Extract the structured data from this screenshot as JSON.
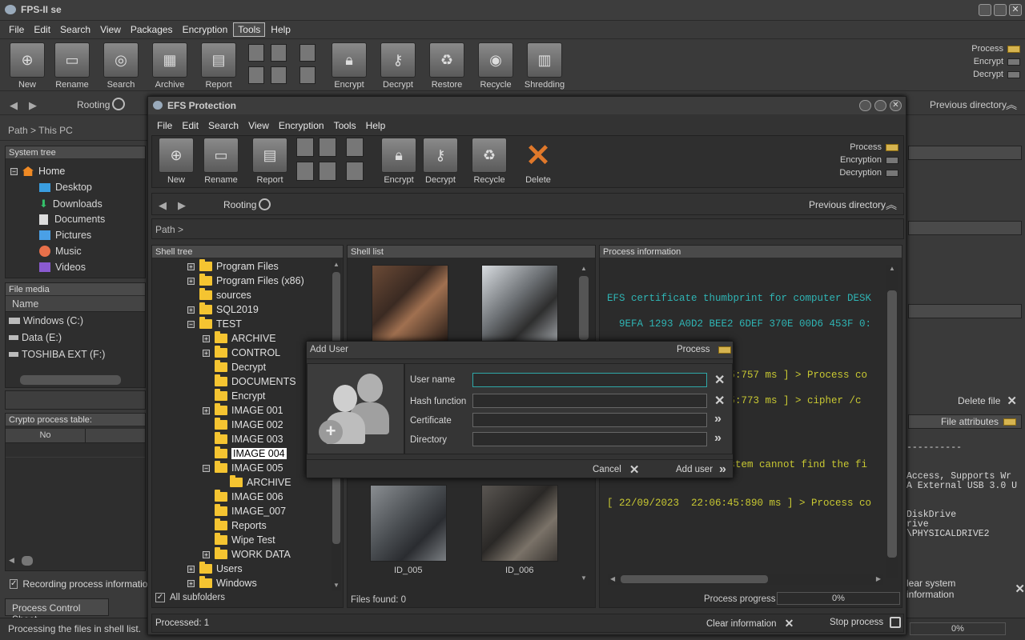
{
  "main": {
    "title": "FPS-II se",
    "menu": [
      "File",
      "Edit",
      "Search",
      "View",
      "Packages",
      "Encryption",
      "Tools",
      "Help"
    ],
    "toolbar": [
      "New",
      "Rename",
      "Search",
      "Archive",
      "Report",
      "Encrypt",
      "Decrypt",
      "Restore",
      "Recycle",
      "Shredding"
    ],
    "indicators": [
      "Process",
      "Encrypt",
      "Decrypt"
    ],
    "rooting": "Rooting",
    "previous_directory": "Previous directory",
    "path": "Path >  This PC",
    "system_tree_header": "System tree",
    "system_tree": [
      "Home",
      "Desktop",
      "Downloads",
      "Documents",
      "Pictures",
      "Music",
      "Videos"
    ],
    "file_media_header": "File media",
    "name_col": "Name",
    "drives": [
      "Windows  (C:)",
      "Data (E:)",
      "TOSHIBA EXT (F:)"
    ],
    "crypto_table_header": "Crypto process table:",
    "crypto_col_no": "No",
    "recording": "Recording process information C",
    "process_sheet_tab": "Process Control Sheet",
    "status": "Processing the files in shell list.",
    "delete_file": "Delete file",
    "file_attributes": "File attributes",
    "clear_system_info": "lear system information",
    "bottom_percent": "0%",
    "right_text": [
      "----------",
      "Access, Supports Wr",
      "A External USB 3.0 U",
      "DiskDrive",
      "rive",
      "\\PHYSICALDRIVE2"
    ]
  },
  "efs": {
    "title": "EFS Protection",
    "menu": [
      "File",
      "Edit",
      "Search",
      "View",
      "Encryption",
      "Tools",
      "Help"
    ],
    "toolbar": [
      "New",
      "Rename",
      "Report",
      "Encrypt",
      "Decrypt",
      "Recycle",
      "Delete"
    ],
    "indicators": [
      "Process",
      "Encryption",
      "Decryption"
    ],
    "rooting": "Rooting",
    "previous_directory": "Previous directory",
    "path": "Path >",
    "shell_tree_header": "Shell tree",
    "shell_list_header": "Shell list",
    "process_info_header": "Process information",
    "tree": [
      {
        "label": "Program Files",
        "lvl": 0,
        "pm": "+"
      },
      {
        "label": "Program Files (x86)",
        "lvl": 0,
        "pm": "+"
      },
      {
        "label": "sources",
        "lvl": 0,
        "pm": ""
      },
      {
        "label": "SQL2019",
        "lvl": 0,
        "pm": "+"
      },
      {
        "label": "TEST",
        "lvl": 0,
        "pm": "-"
      },
      {
        "label": "ARCHIVE",
        "lvl": 1,
        "pm": "+"
      },
      {
        "label": "CONTROL",
        "lvl": 1,
        "pm": "+"
      },
      {
        "label": "Decrypt",
        "lvl": 1,
        "pm": ""
      },
      {
        "label": "DOCUMENTS",
        "lvl": 1,
        "pm": ""
      },
      {
        "label": "Encrypt",
        "lvl": 1,
        "pm": ""
      },
      {
        "label": "IMAGE 001",
        "lvl": 1,
        "pm": "+"
      },
      {
        "label": "IMAGE 002",
        "lvl": 1,
        "pm": ""
      },
      {
        "label": "IMAGE 003",
        "lvl": 1,
        "pm": ""
      },
      {
        "label": "IMAGE 004",
        "lvl": 1,
        "pm": "",
        "selected": true
      },
      {
        "label": "IMAGE 005",
        "lvl": 1,
        "pm": "-"
      },
      {
        "label": "ARCHIVE",
        "lvl": 2,
        "pm": ""
      },
      {
        "label": "IMAGE 006",
        "lvl": 1,
        "pm": ""
      },
      {
        "label": "IMAGE_007",
        "lvl": 1,
        "pm": ""
      },
      {
        "label": "Reports",
        "lvl": 1,
        "pm": ""
      },
      {
        "label": "Wipe Test",
        "lvl": 1,
        "pm": ""
      },
      {
        "label": "WORK DATA",
        "lvl": 1,
        "pm": "+"
      },
      {
        "label": "Users",
        "lvl": 0,
        "pm": "+"
      },
      {
        "label": "Windows",
        "lvl": 0,
        "pm": "+"
      }
    ],
    "all_subfolders": "All subfolders",
    "thumbs": [
      "ID_005",
      "ID_006"
    ],
    "files_found": "Files found: 0",
    "process_lines": [
      "EFS certificate thumbprint for computer DESK",
      "  9EFA 1293 A0D2 BEE2 6DEF 370E 00D6 453F 0:",
      "45:757 ms ] > Process co",
      "45:773 ms ] > cipher /c",
      "ystem cannot find the fi",
      "[ 22/09/2023  22:06:45:890 ms ] > Process co"
    ],
    "process_progress": "Process progress",
    "progress_value": "0%",
    "processed": "Processed: 1",
    "clear_information": "Clear information",
    "stop_process": "Stop process"
  },
  "dialog": {
    "title": "Add User",
    "process": "Process",
    "user_name": "User name",
    "hash_function": "Hash function",
    "certificate": "Certificate",
    "directory": "Directory",
    "cancel": "Cancel",
    "add_user": "Add user"
  },
  "colors": {
    "accent": "#d6b450",
    "folder": "#f5c431",
    "teal": "#2fb4b4",
    "yellow_text": "#c8c832"
  }
}
